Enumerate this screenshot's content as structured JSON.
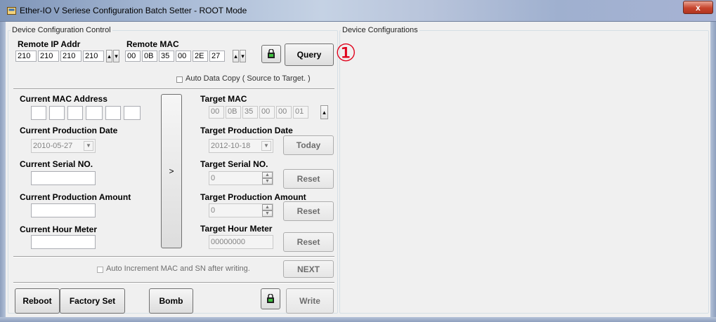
{
  "window": {
    "title": "Ether-IO V Seriese Configuration Batch Setter - ROOT Mode",
    "close_label": "x"
  },
  "device_config_control": {
    "label": "Device Configuration Control",
    "remote_ip_label": "Remote IP Addr",
    "remote_ip": [
      "210",
      "210",
      "210",
      "210"
    ],
    "remote_mac_label": "Remote MAC",
    "remote_mac": [
      "00",
      "0B",
      "35",
      "00",
      "2E",
      "27"
    ],
    "query_label": "Query",
    "annotation": "①",
    "auto_copy_label": "Auto Data Copy ( Source to Target. )",
    "current_mac_label": "Current MAC Address",
    "current_mac": [
      "",
      "",
      "",
      "",
      "",
      ""
    ],
    "current_prod_date_label": "Current Production Date",
    "current_prod_date": "2010-05-27",
    "current_serial_label": "Current Serial NO.",
    "current_serial": "",
    "current_prod_amount_label": "Current Production Amount",
    "current_prod_amount": "",
    "current_hour_label": "Current Hour Meter",
    "current_hour": "",
    "copy_arrow_label": ">",
    "target_mac_label": "Target MAC",
    "target_mac": [
      "00",
      "0B",
      "35",
      "00",
      "00",
      "01"
    ],
    "target_prod_date_label": "Target Production Date",
    "target_prod_date": "2012-10-18",
    "today_label": "Today",
    "target_serial_label": "Target Serial NO.",
    "target_serial": "0",
    "target_prod_amount_label": "Target Production Amount",
    "target_prod_amount": "0",
    "target_hour_label": "Target Hour Meter",
    "target_hour": "00000000",
    "reset_label": "Reset",
    "auto_increment_label": "Auto Increment MAC and SN after writing.",
    "next_label": "NEXT",
    "reboot_label": "Reboot",
    "factory_set_label": "Factory Set",
    "bomb_label": "Bomb",
    "write_label": "Write"
  },
  "device_configurations": {
    "label": "Device Configurations"
  }
}
